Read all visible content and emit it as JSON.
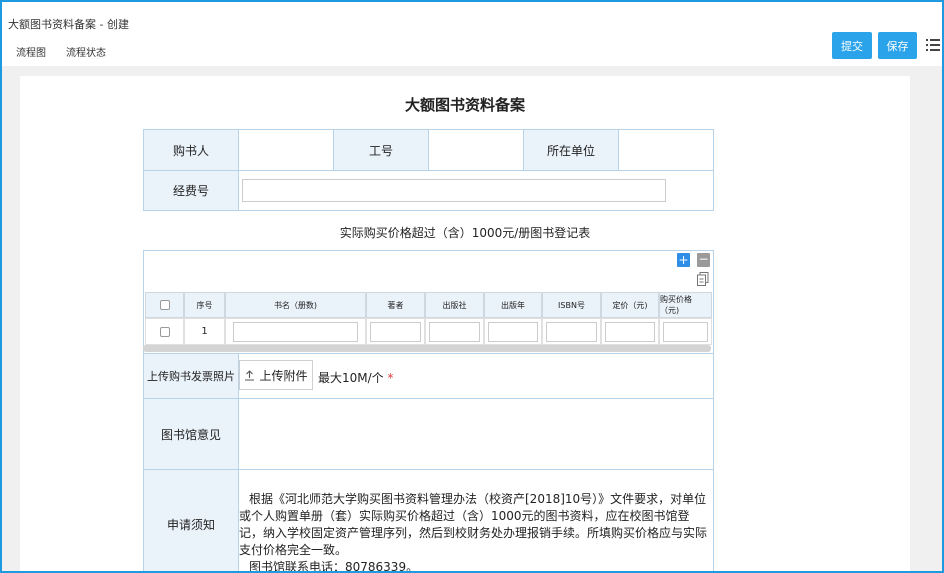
{
  "window": {
    "title": "大额图书资料备案 - 创建",
    "menu": [
      "流程图",
      "流程状态"
    ],
    "submit_label": "提交",
    "save_label": "保存"
  },
  "form": {
    "title": "大额图书资料备案",
    "fields": {
      "buyer_label": "购书人",
      "staff_id_label": "工号",
      "unit_label": "所在单位",
      "fund_label": "经费号"
    },
    "book_table": {
      "title": "实际购买价格超过（含）1000元/册图书登记表",
      "add_icon": "plus-icon",
      "remove_icon": "minus-icon",
      "columns": [
        "序号",
        "书名（册数)",
        "著者",
        "出版社",
        "出版年",
        "ISBN号",
        "定价（元)",
        "购买价格（元)"
      ],
      "rows": [
        {
          "index": "1"
        }
      ]
    },
    "upload": {
      "label": "上传购书发票照片",
      "button_label": "上传附件",
      "hint": "最大10M/个",
      "required_mark": "*"
    },
    "library_opinion_label": "图书馆意见",
    "notice": {
      "label": "申请须知",
      "text": "根据《河北师范大学购买图书资料管理办法（校资产[2018]10号）》文件要求，对单位或个人购置单册（套）实际购买价格超过（含）1000元的图书资料，应在校图书馆登记，纳入学校固定资产管理序列，然后到校财务处办理报销手续。所填购买价格应与实际支付价格完全一致。",
      "contact": "图书馆联系电话：80786339。"
    }
  },
  "colors": {
    "accent": "#2aa3ea",
    "border": "#b6d3ea",
    "label_bg": "#eaf2fa",
    "required": "#e53935"
  }
}
